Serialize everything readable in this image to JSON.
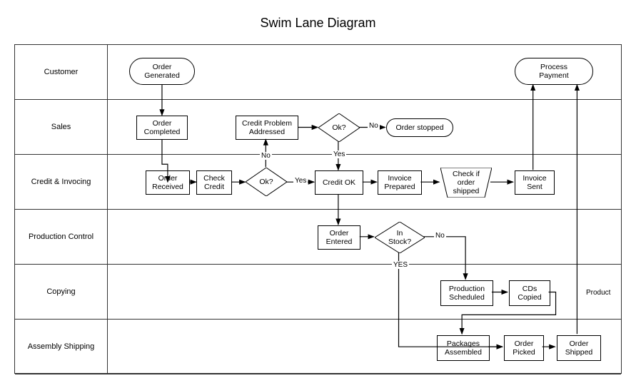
{
  "title": "Swim Lane Diagram",
  "lanes": [
    {
      "label": "Customer"
    },
    {
      "label": "Sales"
    },
    {
      "label": "Credit & Invocing"
    },
    {
      "label": "Production Control"
    },
    {
      "label": "Copying"
    },
    {
      "label": "Assembly Shipping"
    }
  ],
  "nodes": {
    "order_generated": "Order\nGenerated",
    "process_payment": "Process\nPayment",
    "order_completed": "Order\nCompleted",
    "credit_problem": "Credit Problem\nAddressed",
    "ok1": "Ok?",
    "order_stopped": "Order stopped",
    "order_received": "Order\nReceived",
    "check_credit": "Check\nCredit",
    "ok2": "Ok?",
    "credit_ok": "Credit OK",
    "invoice_prepared": "Invoice\nPrepared",
    "check_shipped": "Check if\norder\nshipped",
    "invoice_sent": "Invoice\nSent",
    "order_entered": "Order\nEntered",
    "in_stock": "In\nStock?",
    "production_scheduled": "Production\nScheduled",
    "cds_copied": "CDs\nCopied",
    "packages_assembled": "Packages\nAssembled",
    "order_picked": "Order\nPicked",
    "order_shipped": "Order\nShipped"
  },
  "edge_labels": {
    "no1": "No",
    "yes1": "Yes",
    "no2": "No",
    "yes2": "Yes",
    "no3": "No",
    "yes3": "YES",
    "product": "Product"
  },
  "chart_data": {
    "type": "swimlane",
    "title": "Swim Lane Diagram",
    "lanes": [
      "Customer",
      "Sales",
      "Credit & Invocing",
      "Production Control",
      "Copying",
      "Assembly Shipping"
    ],
    "nodes": [
      {
        "id": "order_generated",
        "label": "Order Generated",
        "lane": "Customer",
        "shape": "terminator"
      },
      {
        "id": "process_payment",
        "label": "Process Payment",
        "lane": "Customer",
        "shape": "terminator"
      },
      {
        "id": "order_completed",
        "label": "Order Completed",
        "lane": "Sales",
        "shape": "process"
      },
      {
        "id": "credit_problem",
        "label": "Credit Problem Addressed",
        "lane": "Sales",
        "shape": "process"
      },
      {
        "id": "ok1",
        "label": "Ok?",
        "lane": "Sales",
        "shape": "decision"
      },
      {
        "id": "order_stopped",
        "label": "Order stopped",
        "lane": "Sales",
        "shape": "terminator"
      },
      {
        "id": "order_received",
        "label": "Order Received",
        "lane": "Credit & Invocing",
        "shape": "process"
      },
      {
        "id": "check_credit",
        "label": "Check Credit",
        "lane": "Credit & Invocing",
        "shape": "process"
      },
      {
        "id": "ok2",
        "label": "Ok?",
        "lane": "Credit & Invocing",
        "shape": "decision"
      },
      {
        "id": "credit_ok",
        "label": "Credit OK",
        "lane": "Credit & Invocing",
        "shape": "process"
      },
      {
        "id": "invoice_prepared",
        "label": "Invoice Prepared",
        "lane": "Credit & Invocing",
        "shape": "process"
      },
      {
        "id": "check_shipped",
        "label": "Check if order shipped",
        "lane": "Credit & Invocing",
        "shape": "manual"
      },
      {
        "id": "invoice_sent",
        "label": "Invoice Sent",
        "lane": "Credit & Invocing",
        "shape": "process"
      },
      {
        "id": "order_entered",
        "label": "Order Entered",
        "lane": "Production Control",
        "shape": "process"
      },
      {
        "id": "in_stock",
        "label": "In Stock?",
        "lane": "Production Control",
        "shape": "decision"
      },
      {
        "id": "production_scheduled",
        "label": "Production Scheduled",
        "lane": "Copying",
        "shape": "process"
      },
      {
        "id": "cds_copied",
        "label": "CDs Copied",
        "lane": "Copying",
        "shape": "process"
      },
      {
        "id": "packages_assembled",
        "label": "Packages Assembled",
        "lane": "Assembly Shipping",
        "shape": "process"
      },
      {
        "id": "order_picked",
        "label": "Order Picked",
        "lane": "Assembly Shipping",
        "shape": "process"
      },
      {
        "id": "order_shipped",
        "label": "Order Shipped",
        "lane": "Assembly Shipping",
        "shape": "process"
      }
    ],
    "edges": [
      {
        "from": "order_generated",
        "to": "order_completed"
      },
      {
        "from": "order_completed",
        "to": "order_received"
      },
      {
        "from": "order_received",
        "to": "check_credit"
      },
      {
        "from": "check_credit",
        "to": "ok2"
      },
      {
        "from": "ok2",
        "to": "credit_ok",
        "label": "Yes"
      },
      {
        "from": "ok2",
        "to": "credit_problem",
        "label": "No"
      },
      {
        "from": "credit_problem",
        "to": "ok1"
      },
      {
        "from": "ok1",
        "to": "order_stopped",
        "label": "No"
      },
      {
        "from": "ok1",
        "to": "credit_ok",
        "label": "Yes"
      },
      {
        "from": "credit_ok",
        "to": "invoice_prepared"
      },
      {
        "from": "credit_ok",
        "to": "order_entered"
      },
      {
        "from": "invoice_prepared",
        "to": "check_shipped"
      },
      {
        "from": "check_shipped",
        "to": "invoice_sent"
      },
      {
        "from": "invoice_sent",
        "to": "process_payment"
      },
      {
        "from": "order_entered",
        "to": "in_stock"
      },
      {
        "from": "in_stock",
        "to": "production_scheduled",
        "label": "No"
      },
      {
        "from": "in_stock",
        "to": "order_picked",
        "label": "YES"
      },
      {
        "from": "production_scheduled",
        "to": "cds_copied"
      },
      {
        "from": "cds_copied",
        "to": "packages_assembled"
      },
      {
        "from": "packages_assembled",
        "to": "order_picked"
      },
      {
        "from": "order_picked",
        "to": "order_shipped"
      },
      {
        "from": "order_shipped",
        "to": "process_payment",
        "label": "Product"
      }
    ]
  }
}
